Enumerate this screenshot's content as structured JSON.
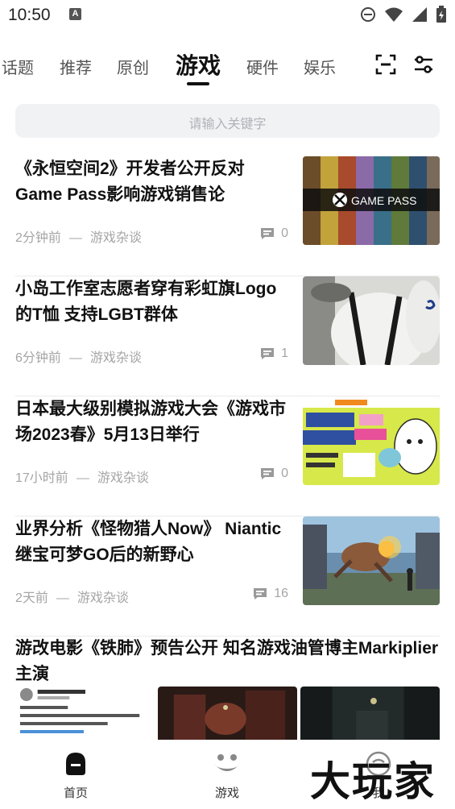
{
  "status_bar": {
    "time": "10:50",
    "notif_badge": "A"
  },
  "tabs": [
    {
      "label": "话题"
    },
    {
      "label": "推荐"
    },
    {
      "label": "原创"
    },
    {
      "label": "游戏",
      "active": true
    },
    {
      "label": "硬件"
    },
    {
      "label": "娱乐"
    }
  ],
  "toolbar": {
    "scan_icon": "scan-icon",
    "filter_icon": "filter-settings-icon"
  },
  "search": {
    "placeholder": "请输入关键字"
  },
  "articles": [
    {
      "title": "《永恒空间2》开发者公开反对Game Pass影响游戏销售论",
      "time": "2分钟前",
      "separator": "—",
      "category": "游戏杂谈",
      "comments": "0",
      "thumb_text": "GAME PASS"
    },
    {
      "title": "小岛工作室志愿者穿有彩虹旗Logo的T恤 支持LGBT群体",
      "time": "6分钟前",
      "separator": "—",
      "category": "游戏杂谈",
      "comments": "1"
    },
    {
      "title": "日本最大级别模拟游戏大会《游戏市场2023春》5月13日举行",
      "time": "17小时前",
      "separator": "—",
      "category": "游戏杂谈",
      "comments": "0"
    },
    {
      "title": "业界分析《怪物猎人Now》 Niantic继宝可梦GO后的新野心",
      "time": "2天前",
      "separator": "—",
      "category": "游戏杂谈",
      "comments": "16"
    }
  ],
  "article5": {
    "title": "游改电影《铁肺》预告公开 知名游戏油管博主Markiplier主演"
  },
  "bottom_nav": [
    {
      "label": "首页",
      "icon": "home-icon"
    },
    {
      "label": "游戏",
      "icon": "game-face-icon"
    },
    {
      "label": "我",
      "icon": "profile-icon"
    }
  ],
  "watermark": "大玩家",
  "colors": {
    "accent": "#111111",
    "meta": "#a5a5a5",
    "search_bg": "#f1f2f4"
  }
}
